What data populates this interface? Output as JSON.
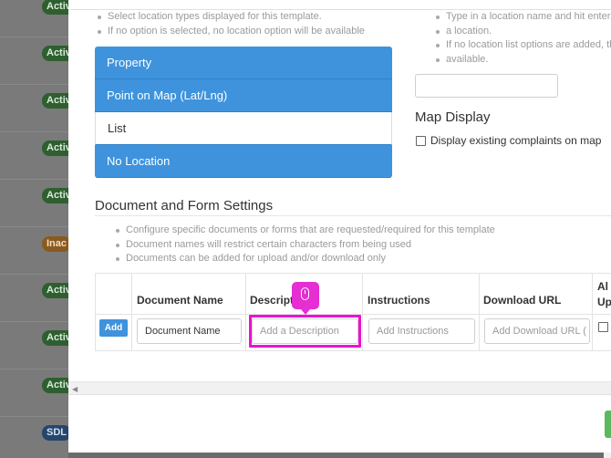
{
  "background_list": {
    "badges": [
      {
        "label": "Active",
        "kind": "active"
      },
      {
        "label": "Active",
        "kind": "active"
      },
      {
        "label": "Active",
        "kind": "active"
      },
      {
        "label": "Active",
        "kind": "active"
      },
      {
        "label": "Active",
        "kind": "active"
      },
      {
        "label": "Inac",
        "kind": "inactive"
      },
      {
        "label": "Active",
        "kind": "active"
      },
      {
        "label": "Active",
        "kind": "active"
      },
      {
        "label": "Active",
        "kind": "active"
      },
      {
        "label": "SDL",
        "kind": "sdl"
      }
    ]
  },
  "location_settings": {
    "hints_left": [
      "Select location types displayed for this template.",
      "If no option is selected, no location option will be available"
    ],
    "options": [
      {
        "label": "Property",
        "selected": true
      },
      {
        "label": "Point on Map (Lat/Lng)",
        "selected": true
      },
      {
        "label": "List",
        "selected": false
      },
      {
        "label": "No Location",
        "selected": true
      }
    ],
    "hints_right": [
      "Type in a location name and hit enter. C",
      "a location.",
      "If no location list options are added, th",
      "available."
    ],
    "location_input_value": ""
  },
  "map_display": {
    "title": "Map Display",
    "checkbox_label": "Display existing complaints on map",
    "checked": false
  },
  "document_settings": {
    "title": "Document and Form Settings",
    "hints": [
      "Configure specific documents or forms that are requested/required for this template",
      "Document names will restrict certain characters from being used",
      "Documents can be added for upload and/or download only"
    ],
    "columns": [
      "Document Name",
      "Descript",
      "Instructions",
      "Download URL",
      "Al",
      "Up"
    ],
    "add_label": "Add",
    "row": {
      "document_name": "Document Name",
      "description_placeholder": "Add a Description",
      "instructions_placeholder": "Add Instructions",
      "download_url_placeholder": "Add Download URL ("
    }
  },
  "colors": {
    "accent": "#3e93dc",
    "highlight": "#ea13d0"
  }
}
